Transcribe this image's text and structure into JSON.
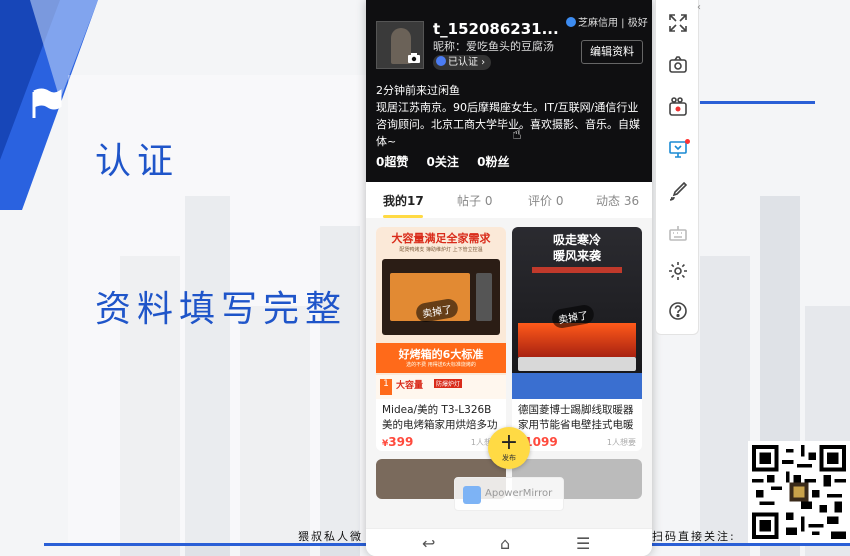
{
  "slide": {
    "heading_1": "认证",
    "heading_2": "资料填写完整",
    "footer_left": "猥叔私人微",
    "footer_right": "扫码直接关注:"
  },
  "profile": {
    "username": "t_152086231...",
    "sesame_credit": "芝麻信用 | 极好",
    "nickname": "昵称：爱吃鱼头的豆腐汤",
    "verified": "已认证",
    "edit_button": "编辑资料",
    "last_seen": "2分钟前来过闲鱼",
    "bio": "现居江苏南京。90后摩羯座女生。IT/互联网/通信行业咨询顾问。北京工商大学毕业。喜欢摄影、音乐。自媒体~",
    "stats": [
      "0超赞",
      "0关注",
      "0粉丝"
    ]
  },
  "tabs": [
    "我的17",
    "帖子 0",
    "评价 0",
    "动态 36"
  ],
  "products": [
    {
      "banner_top": "大容量满足全家需求",
      "banner_sub": "配煲鸭烤支 簿助维炉灯 上下管立控温",
      "sold_tag": "卖掉了",
      "banner_bottom": "好烤箱的6大标准",
      "banner_bottom_sub": "选的不费 用得送6大标准烧烤的",
      "strip": "大容量",
      "strip_sub": "防爆炉灯",
      "title": "Midea/美的 T3-L326B美的电烤箱家用烘焙多功能",
      "price": "399",
      "want": "1人想要"
    },
    {
      "banner_top": "吸走寒冷",
      "banner_top_2": "暖风来袭",
      "sold_tag": "卖掉了",
      "title": "德国菱博士踢脚线取暖器家用节能省电壁挂式电暖",
      "price": "1099",
      "want": "1人想要"
    }
  ],
  "fab_label": "发布",
  "watermark": "ApowerMirror",
  "colors": {
    "accent_yellow": "#ffda44",
    "slide_blue": "#1f55c9",
    "price_red": "#ff4a3d"
  },
  "toolbar_icons": [
    "fullscreen-icon",
    "screenshot-icon",
    "record-icon",
    "cast-icon",
    "brush-icon",
    "keyboard-icon",
    "settings-icon",
    "help-icon"
  ]
}
